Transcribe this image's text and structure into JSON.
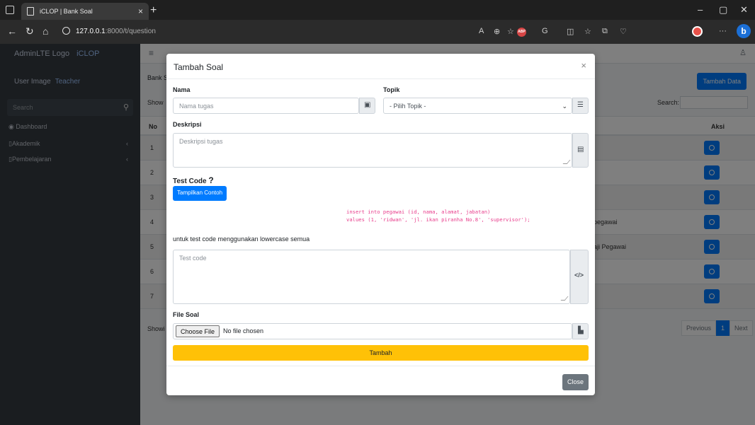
{
  "browser": {
    "tab_title": "iCLOP | Bank Soal",
    "tab_close": "×",
    "new_tab": "+",
    "url_host": "127.0.0.1",
    "url_rest": ":8000/t/question",
    "window_controls": [
      "–",
      "▢",
      "✕"
    ]
  },
  "sidebar": {
    "brand_logo": "AdminLTE Logo",
    "brand_name": "iCLOP",
    "user_image": "User Image",
    "user_name": "Teacher",
    "search_placeholder": "Search",
    "items": [
      {
        "label": "Dashboard",
        "icon": "dashboard-icon"
      },
      {
        "label": "Akademik",
        "chevron": "‹"
      },
      {
        "label": "Pembelajaran",
        "chevron": "‹"
      }
    ]
  },
  "content": {
    "breadcrumb": "Bank S",
    "add_data_button": "Tambah Data",
    "show_label": "Show",
    "search_label": "Search:",
    "col_no": "No",
    "col_aksi": "Aksi",
    "rows": [
      {
        "no": "1",
        "text": ""
      },
      {
        "no": "2",
        "text": ""
      },
      {
        "no": "3",
        "text": ""
      },
      {
        "no": "4",
        "text": "pegawai"
      },
      {
        "no": "5",
        "text": "aji Pegawai"
      },
      {
        "no": "6",
        "text": ""
      },
      {
        "no": "7",
        "text": ""
      }
    ],
    "showing": "Showi",
    "pager_prev": "Previous",
    "pager_current": "1",
    "pager_next": "Next"
  },
  "modal": {
    "title": "Tambah Soal",
    "close_x": "×",
    "nama_label": "Nama",
    "nama_placeholder": "Nama tugas",
    "topik_label": "Topik",
    "topik_selected": "- Pilih Topik -",
    "deskripsi_label": "Deskripsi",
    "deskripsi_placeholder": "Deskripsi tugas",
    "testcode_label": "Test Code",
    "testcode_help": "?",
    "sample_button": "Tampilkan Contoh",
    "sample_code_line1": "insert into pegawai (id, nama, alamat, jabatan)",
    "sample_code_line2": "values (1, 'ridwan', 'jl. ikan piranha No.8', 'supervisor');",
    "note": "untuk test code menggunakan lowercase semua",
    "testcode_placeholder": "Test code",
    "code_icon": "</>",
    "file_label": "File Soal",
    "file_button": "Choose File",
    "file_status": "No file chosen",
    "submit_button": "Tambah",
    "close_button": "Close"
  }
}
